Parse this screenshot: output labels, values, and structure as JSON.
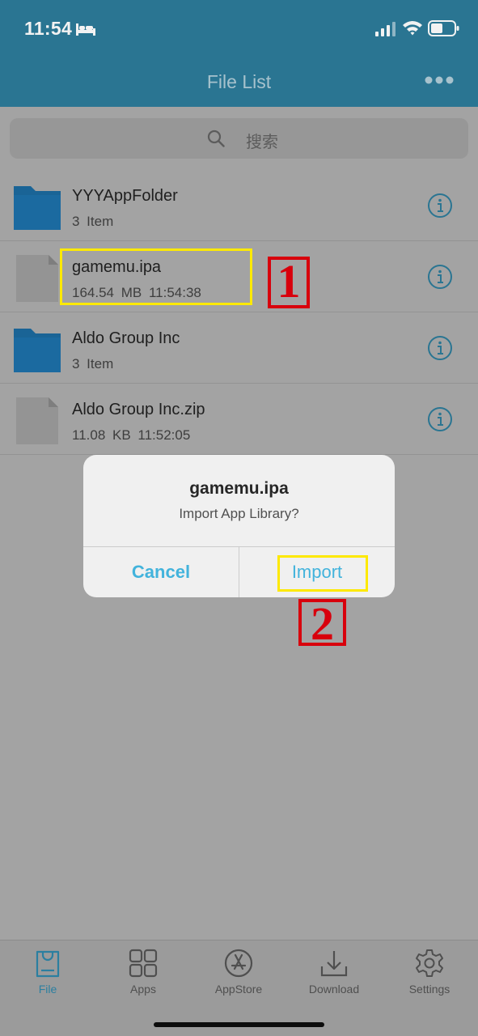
{
  "status": {
    "time": "11:54",
    "icons": [
      "bed-icon",
      "cellular-signal-icon",
      "wifi-icon",
      "battery-icon"
    ]
  },
  "nav": {
    "title": "File List",
    "more_icon": "ellipsis-icon"
  },
  "search": {
    "placeholder": "搜索",
    "icon": "search-icon"
  },
  "files": [
    {
      "name": "YYYAppFolder",
      "meta": "3 Item",
      "type": "folder"
    },
    {
      "name": "gamemu.ipa",
      "meta": "164.54 MB  11:54:38",
      "type": "file"
    },
    {
      "name": "Aldo Group Inc",
      "meta": "3 Item",
      "type": "folder"
    },
    {
      "name": "Aldo Group Inc.zip",
      "meta": "11.08 KB  11:52:05",
      "type": "file"
    }
  ],
  "annotations": {
    "step1": "1",
    "step2": "2",
    "box_color": "#fde900",
    "number_color": "#d8000c"
  },
  "dialog": {
    "title": "gamemu.ipa",
    "message": "Import App Library?",
    "cancel_label": "Cancel",
    "confirm_label": "Import"
  },
  "tabs": [
    {
      "label": "File",
      "icon": "file-bag-icon",
      "active": true
    },
    {
      "label": "Apps",
      "icon": "apps-grid-icon",
      "active": false
    },
    {
      "label": "AppStore",
      "icon": "appstore-icon",
      "active": false
    },
    {
      "label": "Download",
      "icon": "download-icon",
      "active": false
    },
    {
      "label": "Settings",
      "icon": "gear-icon",
      "active": false
    }
  ],
  "colors": {
    "header": "#2a7592",
    "accent": "#42b3dc",
    "folder": "#1a6496",
    "overlay_bg": "#a3a3a3"
  }
}
